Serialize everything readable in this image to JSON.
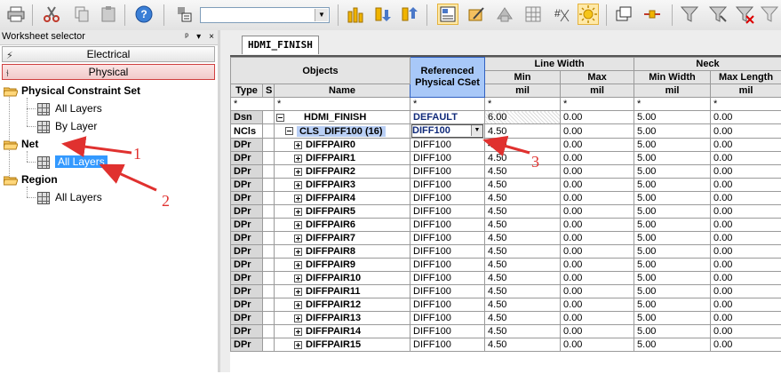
{
  "toolbar": {
    "icons": [
      "print-icon",
      "cut-icon",
      "copy-icon",
      "paste-icon",
      "help-icon",
      "object-filter-icon",
      "net-filter-icon",
      "highlight-icon",
      "dehighlight-icon",
      "dehighlight-all-icon",
      "worksheet-icon",
      "edit-icon",
      "inspect-icon",
      "grid-icon",
      "ratsnest-icon",
      "analyze-icon",
      "window-icon",
      "cross-probe-icon",
      "filter-icon",
      "filter-clear-icon",
      "filter-red-icon",
      "filter-alt-icon"
    ],
    "combo_value": ""
  },
  "worksheet_selector": {
    "title": "Worksheet selector",
    "controls": [
      "ᵖ",
      "▾",
      "×"
    ],
    "domains": [
      {
        "label": "Electrical",
        "selected": false
      },
      {
        "label": "Physical",
        "selected": true
      }
    ],
    "tree": [
      {
        "label": "Physical Constraint Set",
        "level": 0,
        "bold": true
      },
      {
        "label": "All Layers",
        "level": 1
      },
      {
        "label": "By Layer",
        "level": 1
      },
      {
        "label": "Net",
        "level": 0,
        "bold": true
      },
      {
        "label": "All Layers",
        "level": 1,
        "selected": true
      },
      {
        "label": "Region",
        "level": 0,
        "bold": true
      },
      {
        "label": "All Layers",
        "level": 1
      }
    ]
  },
  "sheet": {
    "tab": "HDMI_FINISH",
    "headers": {
      "objects": "Objects",
      "type": "Type",
      "s": "S",
      "name": "Name",
      "referenced": "Referenced Physical CSet",
      "line_width": "Line Width",
      "neck": "Neck",
      "lw_min": "Min",
      "lw_max": "Max",
      "neck_min_width": "Min Width",
      "neck_max_length": "Max Length",
      "unit_mil": "mil"
    },
    "star_row": [
      "*",
      "*",
      "*",
      "*",
      "*",
      "*",
      "*"
    ],
    "rows": [
      {
        "type": "Dsn",
        "name": "HDMI_FINISH",
        "cset": "DEFAULT",
        "lw_min": "6.00",
        "lw_max": "0.00",
        "neck_min": "5.00",
        "neck_max": "0.00"
      },
      {
        "type": "NCls",
        "name": "CLS_DIFF100 (16)",
        "cset": "DIFF100",
        "lw_min": "4.50",
        "lw_max": "0.00",
        "neck_min": "5.00",
        "neck_max": "0.00"
      },
      {
        "type": "DPr",
        "name": "DIFFPAIR0",
        "cset": "DIFF100",
        "lw_min": "4.50",
        "lw_max": "0.00",
        "neck_min": "5.00",
        "neck_max": "0.00"
      },
      {
        "type": "DPr",
        "name": "DIFFPAIR1",
        "cset": "DIFF100",
        "lw_min": "4.50",
        "lw_max": "0.00",
        "neck_min": "5.00",
        "neck_max": "0.00"
      },
      {
        "type": "DPr",
        "name": "DIFFPAIR2",
        "cset": "DIFF100",
        "lw_min": "4.50",
        "lw_max": "0.00",
        "neck_min": "5.00",
        "neck_max": "0.00"
      },
      {
        "type": "DPr",
        "name": "DIFFPAIR3",
        "cset": "DIFF100",
        "lw_min": "4.50",
        "lw_max": "0.00",
        "neck_min": "5.00",
        "neck_max": "0.00"
      },
      {
        "type": "DPr",
        "name": "DIFFPAIR4",
        "cset": "DIFF100",
        "lw_min": "4.50",
        "lw_max": "0.00",
        "neck_min": "5.00",
        "neck_max": "0.00"
      },
      {
        "type": "DPr",
        "name": "DIFFPAIR5",
        "cset": "DIFF100",
        "lw_min": "4.50",
        "lw_max": "0.00",
        "neck_min": "5.00",
        "neck_max": "0.00"
      },
      {
        "type": "DPr",
        "name": "DIFFPAIR6",
        "cset": "DIFF100",
        "lw_min": "4.50",
        "lw_max": "0.00",
        "neck_min": "5.00",
        "neck_max": "0.00"
      },
      {
        "type": "DPr",
        "name": "DIFFPAIR7",
        "cset": "DIFF100",
        "lw_min": "4.50",
        "lw_max": "0.00",
        "neck_min": "5.00",
        "neck_max": "0.00"
      },
      {
        "type": "DPr",
        "name": "DIFFPAIR8",
        "cset": "DIFF100",
        "lw_min": "4.50",
        "lw_max": "0.00",
        "neck_min": "5.00",
        "neck_max": "0.00"
      },
      {
        "type": "DPr",
        "name": "DIFFPAIR9",
        "cset": "DIFF100",
        "lw_min": "4.50",
        "lw_max": "0.00",
        "neck_min": "5.00",
        "neck_max": "0.00"
      },
      {
        "type": "DPr",
        "name": "DIFFPAIR10",
        "cset": "DIFF100",
        "lw_min": "4.50",
        "lw_max": "0.00",
        "neck_min": "5.00",
        "neck_max": "0.00"
      },
      {
        "type": "DPr",
        "name": "DIFFPAIR11",
        "cset": "DIFF100",
        "lw_min": "4.50",
        "lw_max": "0.00",
        "neck_min": "5.00",
        "neck_max": "0.00"
      },
      {
        "type": "DPr",
        "name": "DIFFPAIR12",
        "cset": "DIFF100",
        "lw_min": "4.50",
        "lw_max": "0.00",
        "neck_min": "5.00",
        "neck_max": "0.00"
      },
      {
        "type": "DPr",
        "name": "DIFFPAIR13",
        "cset": "DIFF100",
        "lw_min": "4.50",
        "lw_max": "0.00",
        "neck_min": "5.00",
        "neck_max": "0.00"
      },
      {
        "type": "DPr",
        "name": "DIFFPAIR14",
        "cset": "DIFF100",
        "lw_min": "4.50",
        "lw_max": "0.00",
        "neck_min": "5.00",
        "neck_max": "0.00"
      },
      {
        "type": "DPr",
        "name": "DIFFPAIR15",
        "cset": "DIFF100",
        "lw_min": "4.50",
        "lw_max": "0.00",
        "neck_min": "5.00",
        "neck_max": "0.00"
      }
    ]
  },
  "annotations": [
    "1",
    "2",
    "3"
  ],
  "colors": {
    "selection": "#3399ff",
    "annotation": "#e0312f",
    "referenced_header": "#a8c8f8"
  }
}
